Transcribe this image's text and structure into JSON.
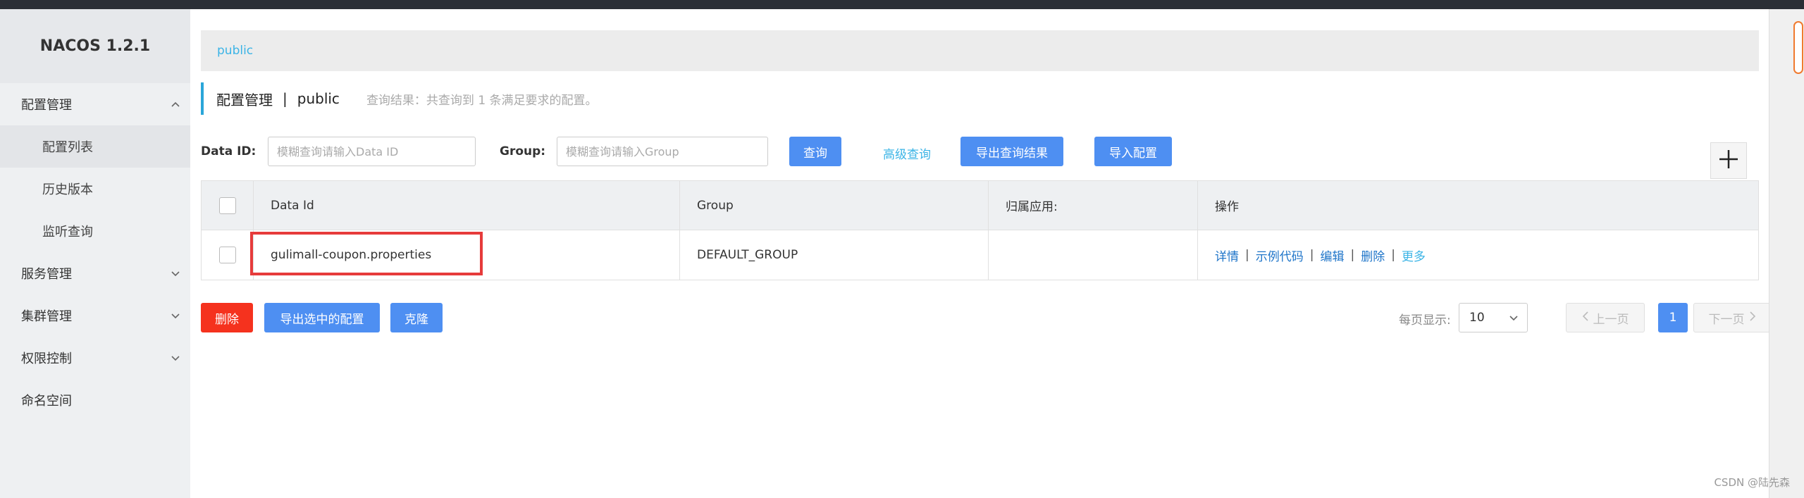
{
  "sidebar": {
    "brand": "NACOS 1.2.1",
    "items": [
      {
        "label": "配置管理"
      },
      {
        "label": "配置列表"
      },
      {
        "label": "历史版本"
      },
      {
        "label": "监听查询"
      },
      {
        "label": "服务管理"
      },
      {
        "label": "集群管理"
      },
      {
        "label": "权限控制"
      },
      {
        "label": "命名空间"
      }
    ]
  },
  "breadcrumb": {
    "namespace": "public"
  },
  "header": {
    "title": "配置管理",
    "separator": "|",
    "namespace": "public",
    "result_text": "查询结果：共查询到 1 条满足要求的配置。"
  },
  "search": {
    "data_id_label": "Data ID:",
    "data_id_placeholder": "模糊查询请输入Data ID",
    "group_label": "Group:",
    "group_placeholder": "模糊查询请输入Group",
    "query_button": "查询",
    "advanced_link": "高级查询",
    "export_results_button": "导出查询结果",
    "import_button": "导入配置",
    "add_icon": "plus-icon"
  },
  "table": {
    "columns": [
      "Data Id",
      "Group",
      "归属应用:",
      "操作"
    ],
    "rows": [
      {
        "data_id": "gulimall-coupon.properties",
        "group": "DEFAULT_GROUP",
        "app": "",
        "actions": {
          "detail": "详情",
          "sample": "示例代码",
          "edit": "编辑",
          "delete": "删除",
          "more": "更多"
        }
      }
    ]
  },
  "footer": {
    "delete_button": "删除",
    "export_selected_button": "导出选中的配置",
    "clone_button": "克隆",
    "per_page_label": "每页显示:",
    "per_page_value": "10",
    "prev_label": "上一页",
    "current_page": "1",
    "next_label": "下一页"
  },
  "watermark": "CSDN @陆先森",
  "colors": {
    "primary": "#4e8ff2",
    "danger": "#f5321e",
    "link": "#3bb4e6",
    "highlight": "#e63b3b"
  }
}
